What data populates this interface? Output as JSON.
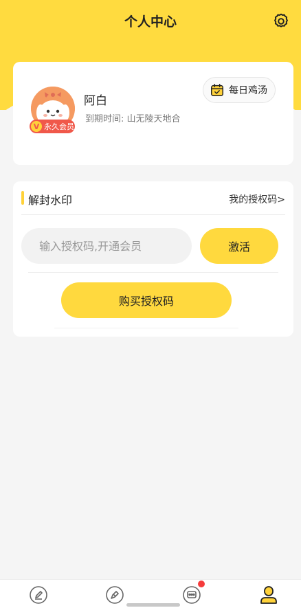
{
  "header": {
    "title": "个人中心"
  },
  "profile": {
    "name": "阿白",
    "expire_text": "到期时间: 山无陵天地合",
    "badge_v": "V",
    "badge_label": "永久会员",
    "daily_soup_label": "每日鸡汤"
  },
  "unlock": {
    "section_title": "解封水印",
    "my_codes_link": "我的授权码>",
    "code_input_placeholder": "输入授权码,开通会员",
    "activate_label": "激活",
    "buy_label": "购买授权码"
  },
  "tabbar": {
    "tabs": [
      {
        "icon": "edit-icon"
      },
      {
        "icon": "pen-icon"
      },
      {
        "icon": "message-icon",
        "has_notification": true
      },
      {
        "icon": "user-icon",
        "active": true
      }
    ]
  },
  "colors": {
    "accent": "#ffdb3f",
    "notification": "#f53b3b",
    "badge": "#f0584a"
  }
}
